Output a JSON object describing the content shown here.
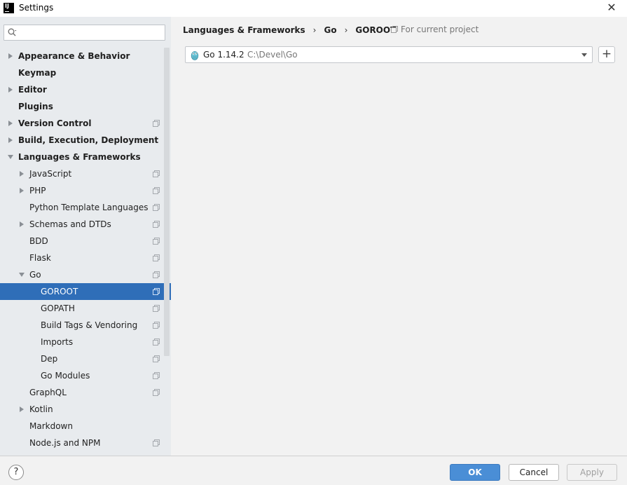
{
  "window": {
    "title": "Settings",
    "logo_text": "IJ"
  },
  "search": {
    "placeholder": "",
    "value": ""
  },
  "tree": [
    {
      "label": "Appearance & Behavior",
      "level": 0,
      "bold": true,
      "arrow": "right",
      "proj": false,
      "selected": false
    },
    {
      "label": "Keymap",
      "level": 0,
      "bold": true,
      "arrow": "none",
      "proj": false,
      "selected": false
    },
    {
      "label": "Editor",
      "level": 0,
      "bold": true,
      "arrow": "right",
      "proj": false,
      "selected": false
    },
    {
      "label": "Plugins",
      "level": 0,
      "bold": true,
      "arrow": "none",
      "proj": false,
      "selected": false
    },
    {
      "label": "Version Control",
      "level": 0,
      "bold": true,
      "arrow": "right",
      "proj": true,
      "selected": false
    },
    {
      "label": "Build, Execution, Deployment",
      "level": 0,
      "bold": true,
      "arrow": "right",
      "proj": false,
      "selected": false
    },
    {
      "label": "Languages & Frameworks",
      "level": 0,
      "bold": true,
      "arrow": "down",
      "proj": false,
      "selected": false
    },
    {
      "label": "JavaScript",
      "level": 1,
      "bold": false,
      "arrow": "right",
      "proj": true,
      "selected": false
    },
    {
      "label": "PHP",
      "level": 1,
      "bold": false,
      "arrow": "right",
      "proj": true,
      "selected": false
    },
    {
      "label": "Python Template Languages",
      "level": 1,
      "bold": false,
      "arrow": "none",
      "proj": true,
      "selected": false
    },
    {
      "label": "Schemas and DTDs",
      "level": 1,
      "bold": false,
      "arrow": "right",
      "proj": true,
      "selected": false
    },
    {
      "label": "BDD",
      "level": 1,
      "bold": false,
      "arrow": "none",
      "proj": true,
      "selected": false
    },
    {
      "label": "Flask",
      "level": 1,
      "bold": false,
      "arrow": "none",
      "proj": true,
      "selected": false
    },
    {
      "label": "Go",
      "level": 1,
      "bold": false,
      "arrow": "down",
      "proj": true,
      "selected": false
    },
    {
      "label": "GOROOT",
      "level": 2,
      "bold": false,
      "arrow": "none",
      "proj": true,
      "selected": true
    },
    {
      "label": "GOPATH",
      "level": 2,
      "bold": false,
      "arrow": "none",
      "proj": true,
      "selected": false
    },
    {
      "label": "Build Tags & Vendoring",
      "level": 2,
      "bold": false,
      "arrow": "none",
      "proj": true,
      "selected": false
    },
    {
      "label": "Imports",
      "level": 2,
      "bold": false,
      "arrow": "none",
      "proj": true,
      "selected": false
    },
    {
      "label": "Dep",
      "level": 2,
      "bold": false,
      "arrow": "none",
      "proj": true,
      "selected": false
    },
    {
      "label": "Go Modules",
      "level": 2,
      "bold": false,
      "arrow": "none",
      "proj": true,
      "selected": false
    },
    {
      "label": "GraphQL",
      "level": 1,
      "bold": false,
      "arrow": "none",
      "proj": true,
      "selected": false
    },
    {
      "label": "Kotlin",
      "level": 1,
      "bold": false,
      "arrow": "right",
      "proj": false,
      "selected": false
    },
    {
      "label": "Markdown",
      "level": 1,
      "bold": false,
      "arrow": "none",
      "proj": false,
      "selected": false
    },
    {
      "label": "Node.js and NPM",
      "level": 1,
      "bold": false,
      "arrow": "none",
      "proj": true,
      "selected": false
    }
  ],
  "content": {
    "breadcrumb": [
      "Languages & Frameworks",
      "Go",
      "GOROOT"
    ],
    "breadcrumb_separator": "›",
    "scope_label": "For current project",
    "sdk": {
      "name": "Go 1.14.2",
      "path": "C:\\Devel\\Go"
    },
    "add_label": "+"
  },
  "footer": {
    "help_label": "?",
    "ok_label": "OK",
    "cancel_label": "Cancel",
    "apply_label": "Apply"
  },
  "colors": {
    "selection": "#2f6eb8",
    "sidebar_bg": "#e8ebee",
    "ok_button": "#4a8ed6"
  }
}
